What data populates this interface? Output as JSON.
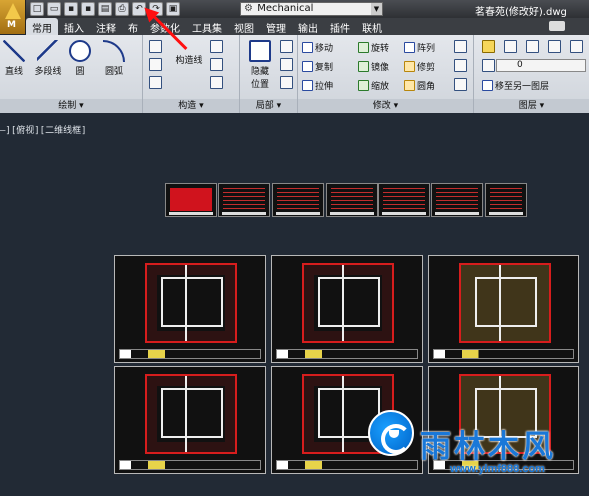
{
  "titlebar": {
    "app_letter": "M",
    "workspace": "Mechanical",
    "document_title": "茗春苑(修改好).dwg"
  },
  "tabs": [
    "常用",
    "插入",
    "注释",
    "布",
    "参数化",
    "工具集",
    "视图",
    "管理",
    "输出",
    "插件",
    "联机"
  ],
  "ribbon": {
    "draw": {
      "title": "绘制",
      "line": "直线",
      "polyline": "多段线",
      "circle": "圆",
      "arc": "圆弧"
    },
    "construct": {
      "title": "构造",
      "construction_line": "构造线"
    },
    "section": {
      "title": "局部",
      "hide": "隐藏",
      "position": "位置"
    },
    "modify": {
      "title": "修改",
      "move": "移动",
      "rotate": "旋转",
      "array": "阵列",
      "copy": "复制",
      "mirror": "镜像",
      "trim": "修剪",
      "stretch": "拉伸",
      "scale": "缩放",
      "fillet": "圆角"
    },
    "layers": {
      "title": "图层",
      "current": "0",
      "move_to_layer": "移至另一图层"
    }
  },
  "viewport": {
    "label": "–][俯视][二维线框]"
  },
  "watermark": {
    "name": "雨林木风",
    "url": "www.ylmf888.com"
  },
  "colors": {
    "canvas": "#222a35",
    "annotation_arrow": "#ff1010",
    "drawing_lines": "#d71d1d"
  }
}
